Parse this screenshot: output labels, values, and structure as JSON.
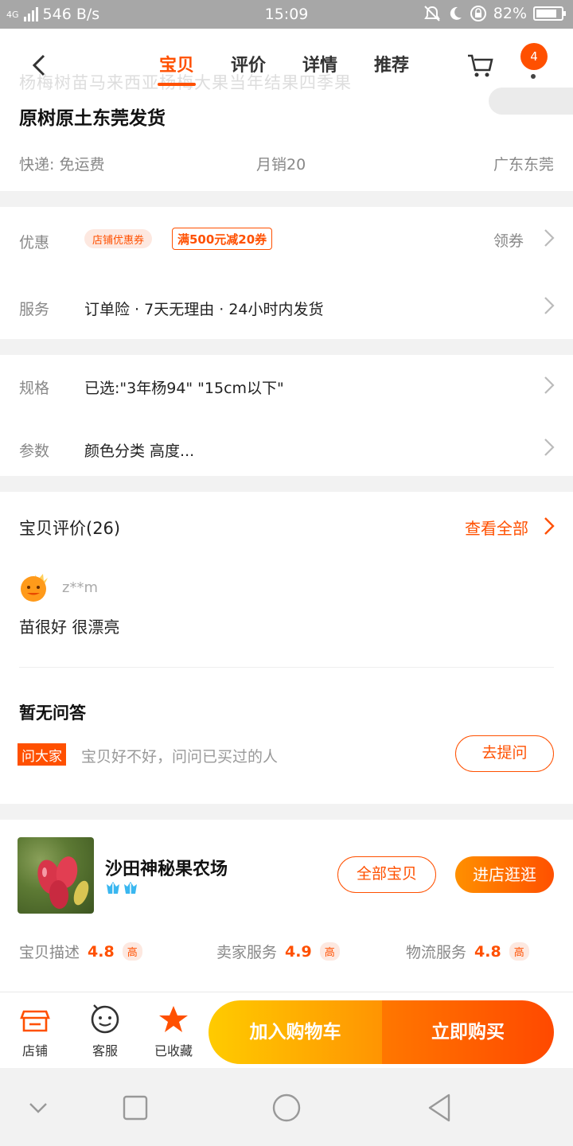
{
  "status_bar": {
    "network": "4G",
    "speed": "546 B/s",
    "time": "15:09",
    "battery_text": "82%",
    "battery_level": 0.82
  },
  "header": {
    "ghost_title": "杨梅树苗马来西亚杨梅大果当年结果四季果",
    "tabs": [
      "宝贝",
      "评价",
      "详情",
      "推荐"
    ],
    "active_tab": 0,
    "cart_badge": "4",
    "accent": "#ff5000"
  },
  "product": {
    "title": "原树原土东莞发货",
    "shipping": "快递: 免运费",
    "monthly_sales": "月销20",
    "location": "广东东莞"
  },
  "promo": {
    "label": "优惠",
    "shop_coupon_tag": "店铺优惠券",
    "coupon": "满500元减20券",
    "action": "领券"
  },
  "service": {
    "label": "服务",
    "text": "订单险 · 7天无理由 · 24小时内发货"
  },
  "spec": {
    "label": "规格",
    "text": "已选:\"3年杨94\" \"15cm以下\""
  },
  "params": {
    "label": "参数",
    "text": "颜色分类 高度..."
  },
  "reviews": {
    "heading": "宝贝评价(26)",
    "view_all": "查看全部",
    "reviewer": "z**m",
    "text": "苗很好 很漂亮"
  },
  "qa": {
    "title": "暂无问答",
    "tag": "问大家",
    "hint": "宝贝好不好，问问已买过的人",
    "button": "去提问"
  },
  "shop": {
    "name": "沙田神秘果农场",
    "all_items_button": "全部宝贝",
    "enter_button": "进店逛逛",
    "scores": [
      {
        "label": "宝贝描述",
        "value": "4.8",
        "level": "高"
      },
      {
        "label": "卖家服务",
        "value": "4.9",
        "level": "高"
      },
      {
        "label": "物流服务",
        "value": "4.8",
        "level": "高"
      }
    ]
  },
  "action_bar": {
    "shop": "店铺",
    "service": "客服",
    "favorite": "已收藏",
    "add_to_cart": "加入购物车",
    "buy_now": "立即购买"
  }
}
